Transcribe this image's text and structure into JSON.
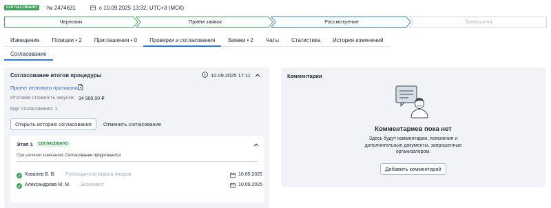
{
  "header": {
    "status_badge": "СОГЛАСОВАНО",
    "procedure_number": "№ 2474631",
    "date_range": "с 10.09.2025 13:32, UTC+3 (МСК)",
    "calendar_icon": "calendar-icon"
  },
  "stepper": {
    "steps": [
      {
        "label": "Черновик",
        "state": "done"
      },
      {
        "label": "Приём заявок",
        "state": "done"
      },
      {
        "label": "Рассмотрение",
        "state": "current"
      },
      {
        "label": "Завершена",
        "state": "future"
      }
    ],
    "colors": {
      "done_border": "#3aa655",
      "current_border": "#2c7be5",
      "future_text": "#b0b8c2"
    }
  },
  "tabs": [
    {
      "label": "Извещение",
      "active": false
    },
    {
      "label": "Позиции • 2",
      "active": false
    },
    {
      "label": "Приглашения • 0",
      "active": false
    },
    {
      "label": "Проверки и согласования",
      "active": true
    },
    {
      "label": "Заявки • 2",
      "active": false
    },
    {
      "label": "Чаты",
      "active": false
    },
    {
      "label": "Статистика",
      "active": false
    },
    {
      "label": "История изменений",
      "active": false
    }
  ],
  "subtabs": [
    {
      "label": "Согласование",
      "active": true
    }
  ],
  "approval": {
    "title": "Согласование итогов процедуры",
    "datetime": "10.09.2025 17:11",
    "protocol_link": "Проект итогового протокола",
    "cost_label": "Итоговая стоимость закупки:",
    "cost_value": "34 900,00 ₽",
    "round": "Круг согласования: 1",
    "history_button": "Открыть историю согласования",
    "cancel_button": "Отменить согласование",
    "stage": {
      "title": "Этап 1",
      "badge": "СОГЛАСОВАНО",
      "note_prefix": "При наличии замечания:",
      "note_value": "Согласование продолжается",
      "approvers": [
        {
          "name": "Ковалев В. В.",
          "role": "Руководитель отдела продаж",
          "date": "10.09.2025"
        },
        {
          "name": "Александрова М. М.",
          "role": "Экономист",
          "date": "10.09.2025"
        }
      ]
    }
  },
  "comments": {
    "title": "Комментарии",
    "empty_title": "Комментариев пока нет",
    "empty_description": "Здесь будут комментарии, пояснения и дополнительные документы, запрошенные организатором.",
    "add_button": "Добавить комментарий",
    "illustration": "person-with-speech-bubble-icon"
  },
  "colors": {
    "accent": "#2c7be5",
    "success": "#3aa655",
    "link": "#2c6fd1",
    "panel_bg": "#f1f3f6"
  }
}
